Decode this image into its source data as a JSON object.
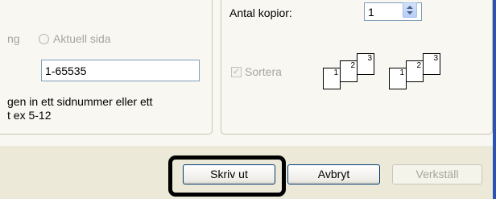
{
  "page_range": {
    "partial_option_label": "ng",
    "current_page_label": "Aktuell sida",
    "pages_value": "1-65535",
    "hint_line1": "gen in ett sidnummer eller ett",
    "hint_line2": "t ex 5-12"
  },
  "copies": {
    "label": "Antal kopior:",
    "value": "1",
    "collate_label": "Sortera",
    "collate_checked": true,
    "collate_pages": [
      "1",
      "2",
      "3"
    ]
  },
  "buttons": {
    "print": "Skriv ut",
    "cancel": "Avbryt",
    "apply": "Verkställ"
  }
}
